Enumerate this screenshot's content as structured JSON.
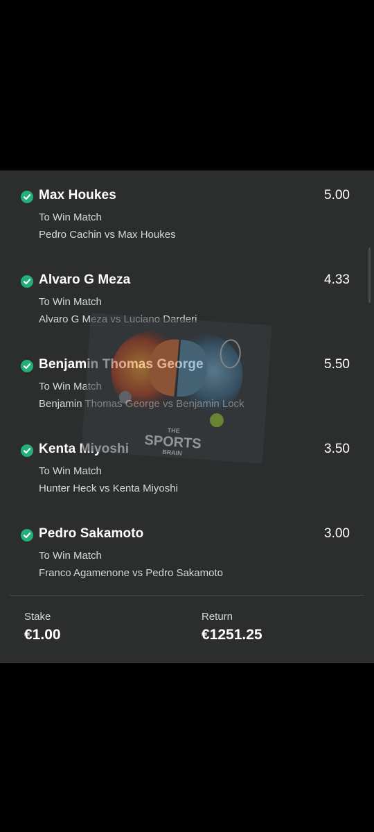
{
  "selections": [
    {
      "name": "Max Houkes",
      "odds": "5.00",
      "market": "To Win Match",
      "event": "Pedro Cachin vs Max Houkes"
    },
    {
      "name": "Alvaro G Meza",
      "odds": "4.33",
      "market": "To Win Match",
      "event": "Alvaro G Meza vs Luciano Darderi"
    },
    {
      "name": "Benjamin Thomas George",
      "odds": "5.50",
      "market": "To Win Match",
      "event": "Benjamin Thomas George vs Benjamin Lock"
    },
    {
      "name": "Kenta Miyoshi",
      "odds": "3.50",
      "market": "To Win Match",
      "event": "Hunter Heck vs Kenta Miyoshi"
    },
    {
      "name": "Pedro Sakamoto",
      "odds": "3.00",
      "market": "To Win Match",
      "event": "Franco Agamenone vs Pedro Sakamoto"
    }
  ],
  "footer": {
    "stake_label": "Stake",
    "stake_value": "€1.00",
    "return_label": "Return",
    "return_value": "€1251.25"
  },
  "watermark": {
    "line1": "THE",
    "line2": "SPORTS",
    "line3": "BRAIN"
  },
  "colors": {
    "background": "#000000",
    "panel": "#2c2e2d",
    "check": "#22b07a"
  },
  "icons": {
    "status": "check-circle-icon"
  }
}
